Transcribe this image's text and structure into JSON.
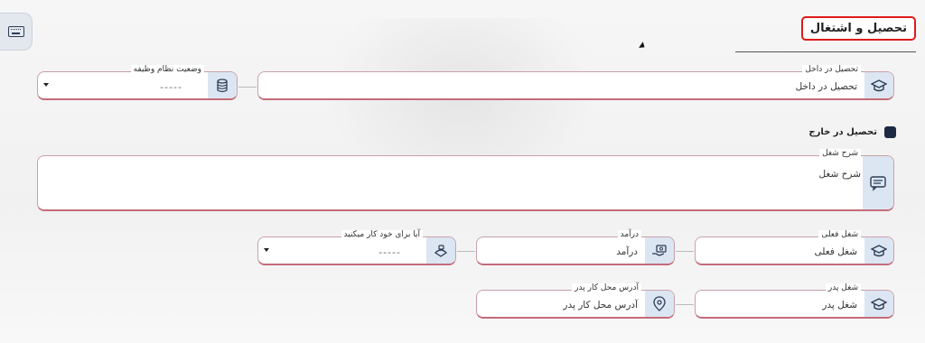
{
  "header": {
    "title": "تحصیل و اشتغال"
  },
  "fields": {
    "study_inside": {
      "label": "تحصیل در داخل",
      "value": "تحصیل در داخل"
    },
    "military_status": {
      "label": "وضعیت نظام وظیفه",
      "value": "-----"
    },
    "study_abroad": {
      "label": "تحصیل در خارج"
    },
    "job_description": {
      "label": "شرح شغل",
      "value": "شرح شغل"
    },
    "current_job": {
      "label": "شغل فعلی",
      "value": "شغل فعلی"
    },
    "income": {
      "label": "درآمد",
      "value": "درآمد"
    },
    "self_employed": {
      "label": "آیا برای خود کار میکنید",
      "value": "-----"
    },
    "father_job": {
      "label": "شغل پدر",
      "value": "شغل پدر"
    },
    "father_work_address": {
      "label": "آدرس محل کار پدر",
      "value": "آدرس محل کار پدر"
    }
  },
  "icons": {
    "corner": "keyboard-icon",
    "study_inside": "graduation-cap-icon",
    "military_status": "database-icon",
    "job_description": "message-icon",
    "current_job": "graduation-cap-icon",
    "income": "money-hand-icon",
    "self_employed": "hand-briefcase-icon",
    "father_job": "graduation-cap-icon",
    "father_work_address": "location-pin-icon"
  },
  "colors": {
    "title_border": "#e01a1a",
    "field_border": "#c56b7a",
    "icon_bg": "#dce6f2",
    "checkbox": "#1c2a44"
  }
}
